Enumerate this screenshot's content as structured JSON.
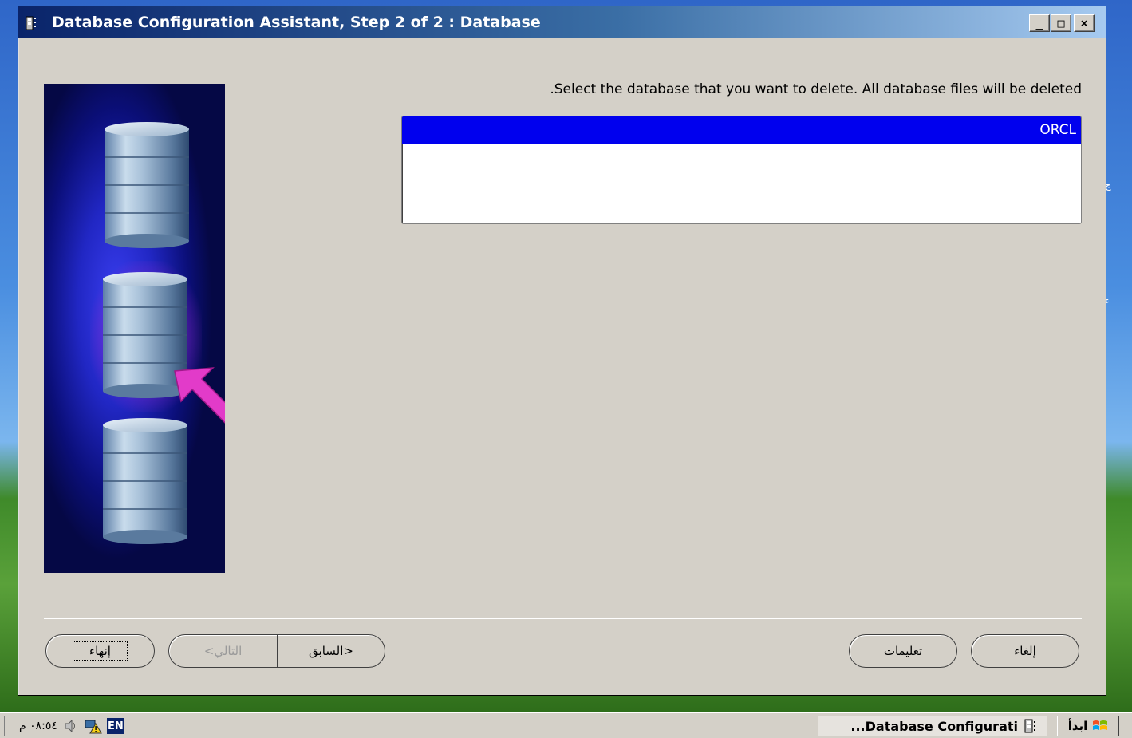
{
  "window": {
    "title": "Database Configuration Assistant, Step 2 of 2 : Database",
    "minimize_glyph": "_",
    "maximize_glyph": "□",
    "close_glyph": "×"
  },
  "main": {
    "instruction": ".Select the database that you want to delete. All database files will be deleted",
    "databases": [
      {
        "name": "ORCL",
        "selected": true
      }
    ]
  },
  "buttons": {
    "finish": "إنهاء",
    "next": "التالي",
    "next_arrow": "<",
    "back": "السابق",
    "back_arrow": ">",
    "help": "تعليمات",
    "cancel": "إلغاء"
  },
  "taskbar": {
    "clock": "٠٨:٥٤ م",
    "language": "EN",
    "task_label": "...Database Configurati",
    "start_label": "ابدأ"
  },
  "desktop": {
    "glyph1": "ج",
    "glyph2": "ء"
  },
  "icons": [
    "app-icon",
    "database-cylinder-icon",
    "pointer-arrow-icon",
    "volume-icon",
    "network-warning-icon",
    "windows-flag-icon"
  ],
  "colors": {
    "selection": "#0000ee",
    "title_start": "#0a246a",
    "title_end": "#a6caf0",
    "arrow": "#e23bc9"
  }
}
